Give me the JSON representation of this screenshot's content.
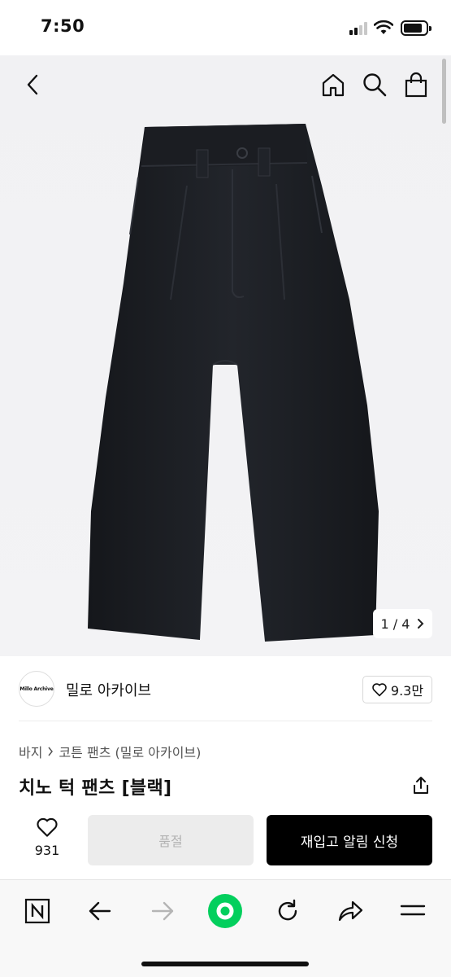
{
  "status_bar": {
    "time": "7:50"
  },
  "hero": {
    "pager_text": "1 / 4"
  },
  "brand": {
    "logo_text": "Millo Archive",
    "name": "밀로 아카이브",
    "follow_count": "9.3만"
  },
  "breadcrumb": {
    "level1": "바지",
    "level2": "코튼 팬츠 (밀로 아카이브)"
  },
  "product": {
    "title": "치노 턱 팬츠 [블랙]"
  },
  "actions": {
    "like_count": "931",
    "soldout_label": "품절",
    "restock_label": "재입고 알림 신청"
  },
  "icons": {
    "top": [
      "back-icon",
      "home-icon",
      "search-icon",
      "shopping-bag-icon"
    ],
    "browser": [
      "naver-logo-icon",
      "arrow-left-icon",
      "arrow-right-icon",
      "green-circle-icon",
      "refresh-icon",
      "share-arrow-icon",
      "menu-icon"
    ]
  },
  "colors": {
    "accent_green": "#03cf5d",
    "primary_button": "#000000",
    "disabled_button": "#ececec"
  }
}
